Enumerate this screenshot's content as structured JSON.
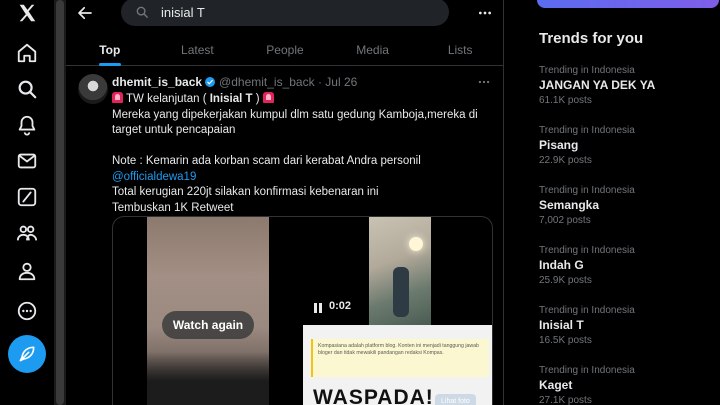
{
  "nav": {
    "icons": [
      "x-logo-icon",
      "home-icon",
      "search-icon",
      "notifications-icon",
      "messages-icon",
      "grok-icon",
      "communities-icon",
      "profile-icon",
      "more-circle-icon"
    ],
    "post_icon": "feather-icon"
  },
  "search": {
    "value": "inisial T"
  },
  "tabs": [
    {
      "label": "Top",
      "active": true
    },
    {
      "label": "Latest",
      "active": false
    },
    {
      "label": "People",
      "active": false
    },
    {
      "label": "Media",
      "active": false
    },
    {
      "label": "Lists",
      "active": false
    }
  ],
  "tweet": {
    "name": "dhemit_is_back",
    "handle": "@dhemit_is_back",
    "dot": "·",
    "date": "Jul 26",
    "line1_a": "TW kelanjutan (",
    "line1_bold": " Inisial T ",
    "line1_b": ")",
    "line2": "Mereka yang dipekerjakan kumpul dlm satu gedung Kamboja,mereka di",
    "line3": "target untuk pencapaian",
    "line4": "Note : Kemarin ada korban scam dari kerabat Andra personil",
    "mention": "@officialdewa19",
    "line6": "Total kerugian 220jt silakan konfirmasi kebenaran ini",
    "line7": "Tembuskan 1K Retweet"
  },
  "media": {
    "watch_again": "Watch again",
    "time": "0:02",
    "note": "Kompasiana adalah platform blog. Konten ini menjadi tanggung jawab bloger dan tidak mewakili pandangan redaksi Kompas.",
    "headline": "WASPADA!",
    "view_photo": "Lihat foto"
  },
  "trends": {
    "title": "Trends for you",
    "items": [
      {
        "meta": "Trending in Indonesia",
        "name": "JANGAN YA DEK YA",
        "posts": "61.1K posts"
      },
      {
        "meta": "Trending in Indonesia",
        "name": "Pisang",
        "posts": "22.9K posts"
      },
      {
        "meta": "Trending in Indonesia",
        "name": "Semangka",
        "posts": "7,002 posts"
      },
      {
        "meta": "Trending in Indonesia",
        "name": "Indah G",
        "posts": "25.9K posts"
      },
      {
        "meta": "Trending in Indonesia",
        "name": "Inisial T",
        "posts": "16.5K posts"
      },
      {
        "meta": "Trending in Indonesia",
        "name": "Kaget",
        "posts": "27.1K posts"
      }
    ]
  },
  "colors": {
    "accent": "#1d9bf0",
    "background": "#000000",
    "text": "#e7e9ea",
    "muted": "#71767b"
  }
}
